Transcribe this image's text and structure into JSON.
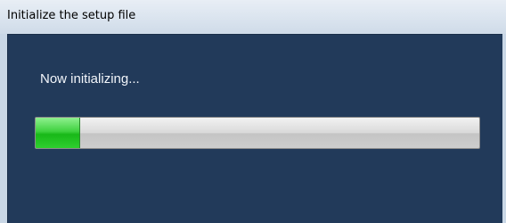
{
  "window": {
    "title": "Initialize the setup file"
  },
  "dialog": {
    "message": "Now initializing...",
    "progress": {
      "fraction": 0.1,
      "fill_color": "#2fcf2f",
      "track_color": "#d0d0d0"
    }
  },
  "colors": {
    "client_background": "#223a5a",
    "titlebar": "#dde6f0"
  }
}
